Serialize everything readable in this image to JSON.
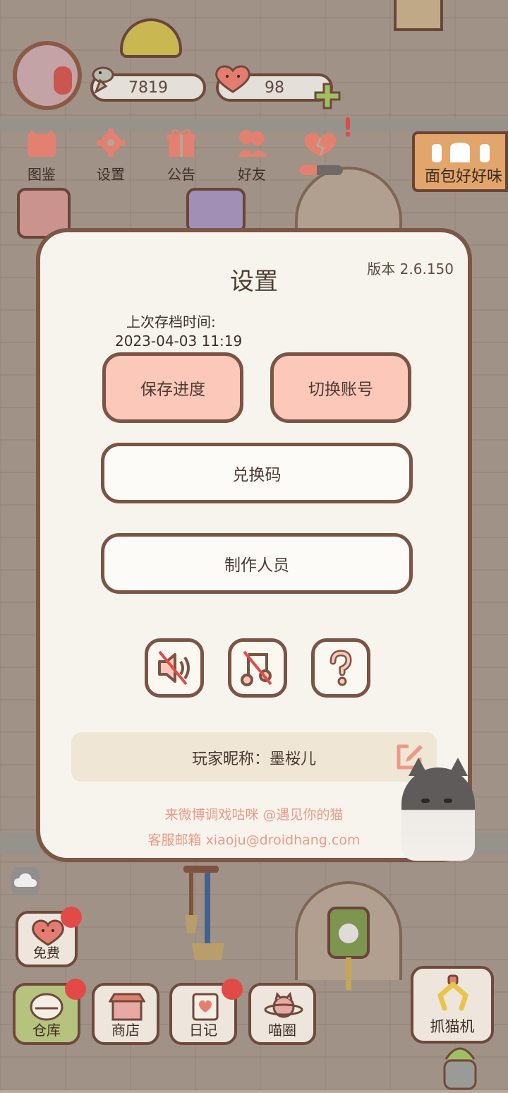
{
  "hud": {
    "fish_count": "7819",
    "heart_count": "98"
  },
  "top_nav": [
    {
      "label": "图鉴"
    },
    {
      "label": "设置"
    },
    {
      "label": "公告"
    },
    {
      "label": "好友"
    }
  ],
  "bread_sign": "面包好好味",
  "settings": {
    "title": "设置",
    "version": "版本 2.6.150",
    "last_save_label": "上次存档时间:",
    "last_save_time": "2023-04-03 11:19",
    "save_button": "保存进度",
    "switch_account_button": "切换账号",
    "redeem_button": "兑换码",
    "credits_button": "制作人员",
    "nickname": "玩家昵称：墨桜儿",
    "weibo_text": "来微博调戏咕咪 @遇见你的猫",
    "email_text": "客服邮箱 xiaoju@droidhang.com",
    "icons": [
      "sound-muted-icon",
      "music-muted-icon",
      "help-icon"
    ]
  },
  "bottom": {
    "free": "免费",
    "tabs": [
      {
        "label": "仓库"
      },
      {
        "label": "商店"
      },
      {
        "label": "日记"
      },
      {
        "label": "喵圈"
      }
    ],
    "claw_machine": "抓猫机"
  },
  "colors": {
    "accent_pink": "#fcc8b9",
    "border_brown": "#7a5444",
    "footer_text": "#ec9a86"
  }
}
